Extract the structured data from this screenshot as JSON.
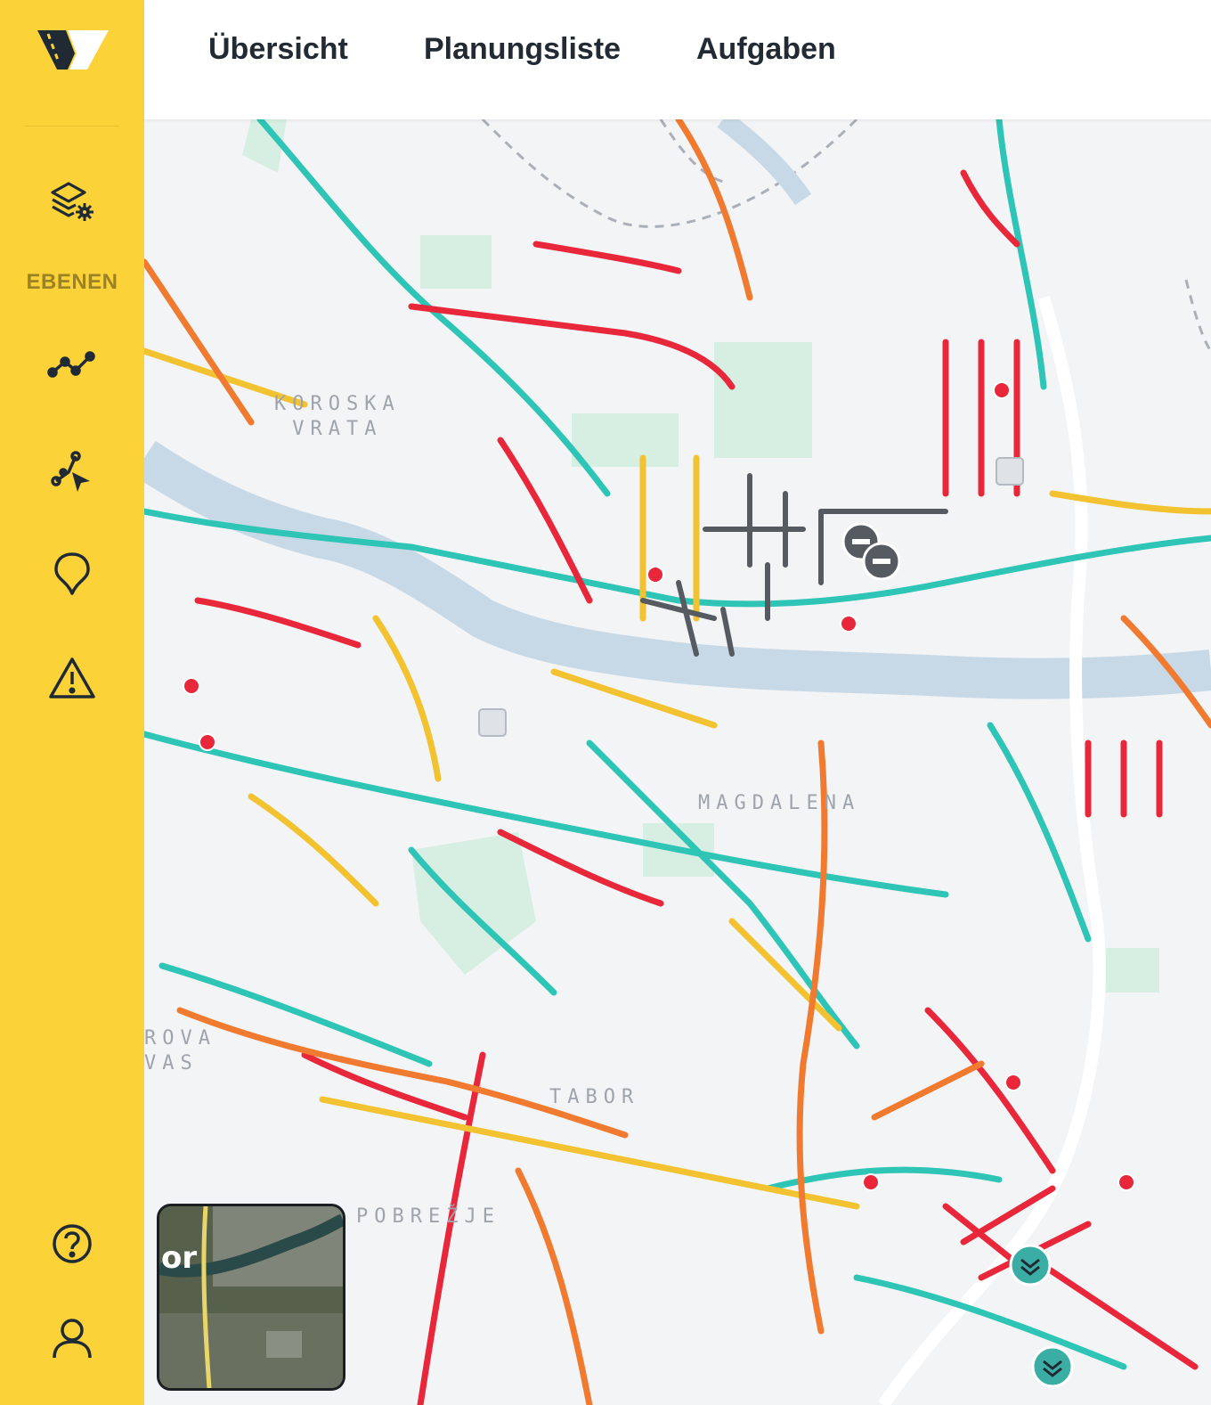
{
  "app": {
    "logo_icon": "v-road-logo",
    "accent_color": "#fbd238"
  },
  "header": {
    "tabs": [
      {
        "label": "Übersicht"
      },
      {
        "label": "Planungsliste"
      },
      {
        "label": "Aufgaben"
      }
    ]
  },
  "sidebar": {
    "items": [
      {
        "icon": "layers-settings-icon",
        "label": "EBENEN"
      },
      {
        "icon": "line-chart-icon"
      },
      {
        "icon": "route-select-icon"
      },
      {
        "icon": "location-pin-icon"
      },
      {
        "icon": "warning-icon"
      }
    ],
    "bottom_items": [
      {
        "icon": "help-icon"
      },
      {
        "icon": "user-icon"
      }
    ]
  },
  "map": {
    "districts": [
      {
        "label": "KOROSKA\nVRATA"
      },
      {
        "label": "MAGDALENA"
      },
      {
        "label": "TABOR"
      },
      {
        "label": "POBREŽJE"
      },
      {
        "label": "ROVA\nVAS"
      }
    ],
    "condition_colors": {
      "good": "#2ec4b6",
      "fair": "#f2c230",
      "poor": "#f07b30",
      "bad": "#e8283a",
      "planned": "#555b60"
    },
    "minimap": {
      "label": "or"
    }
  }
}
